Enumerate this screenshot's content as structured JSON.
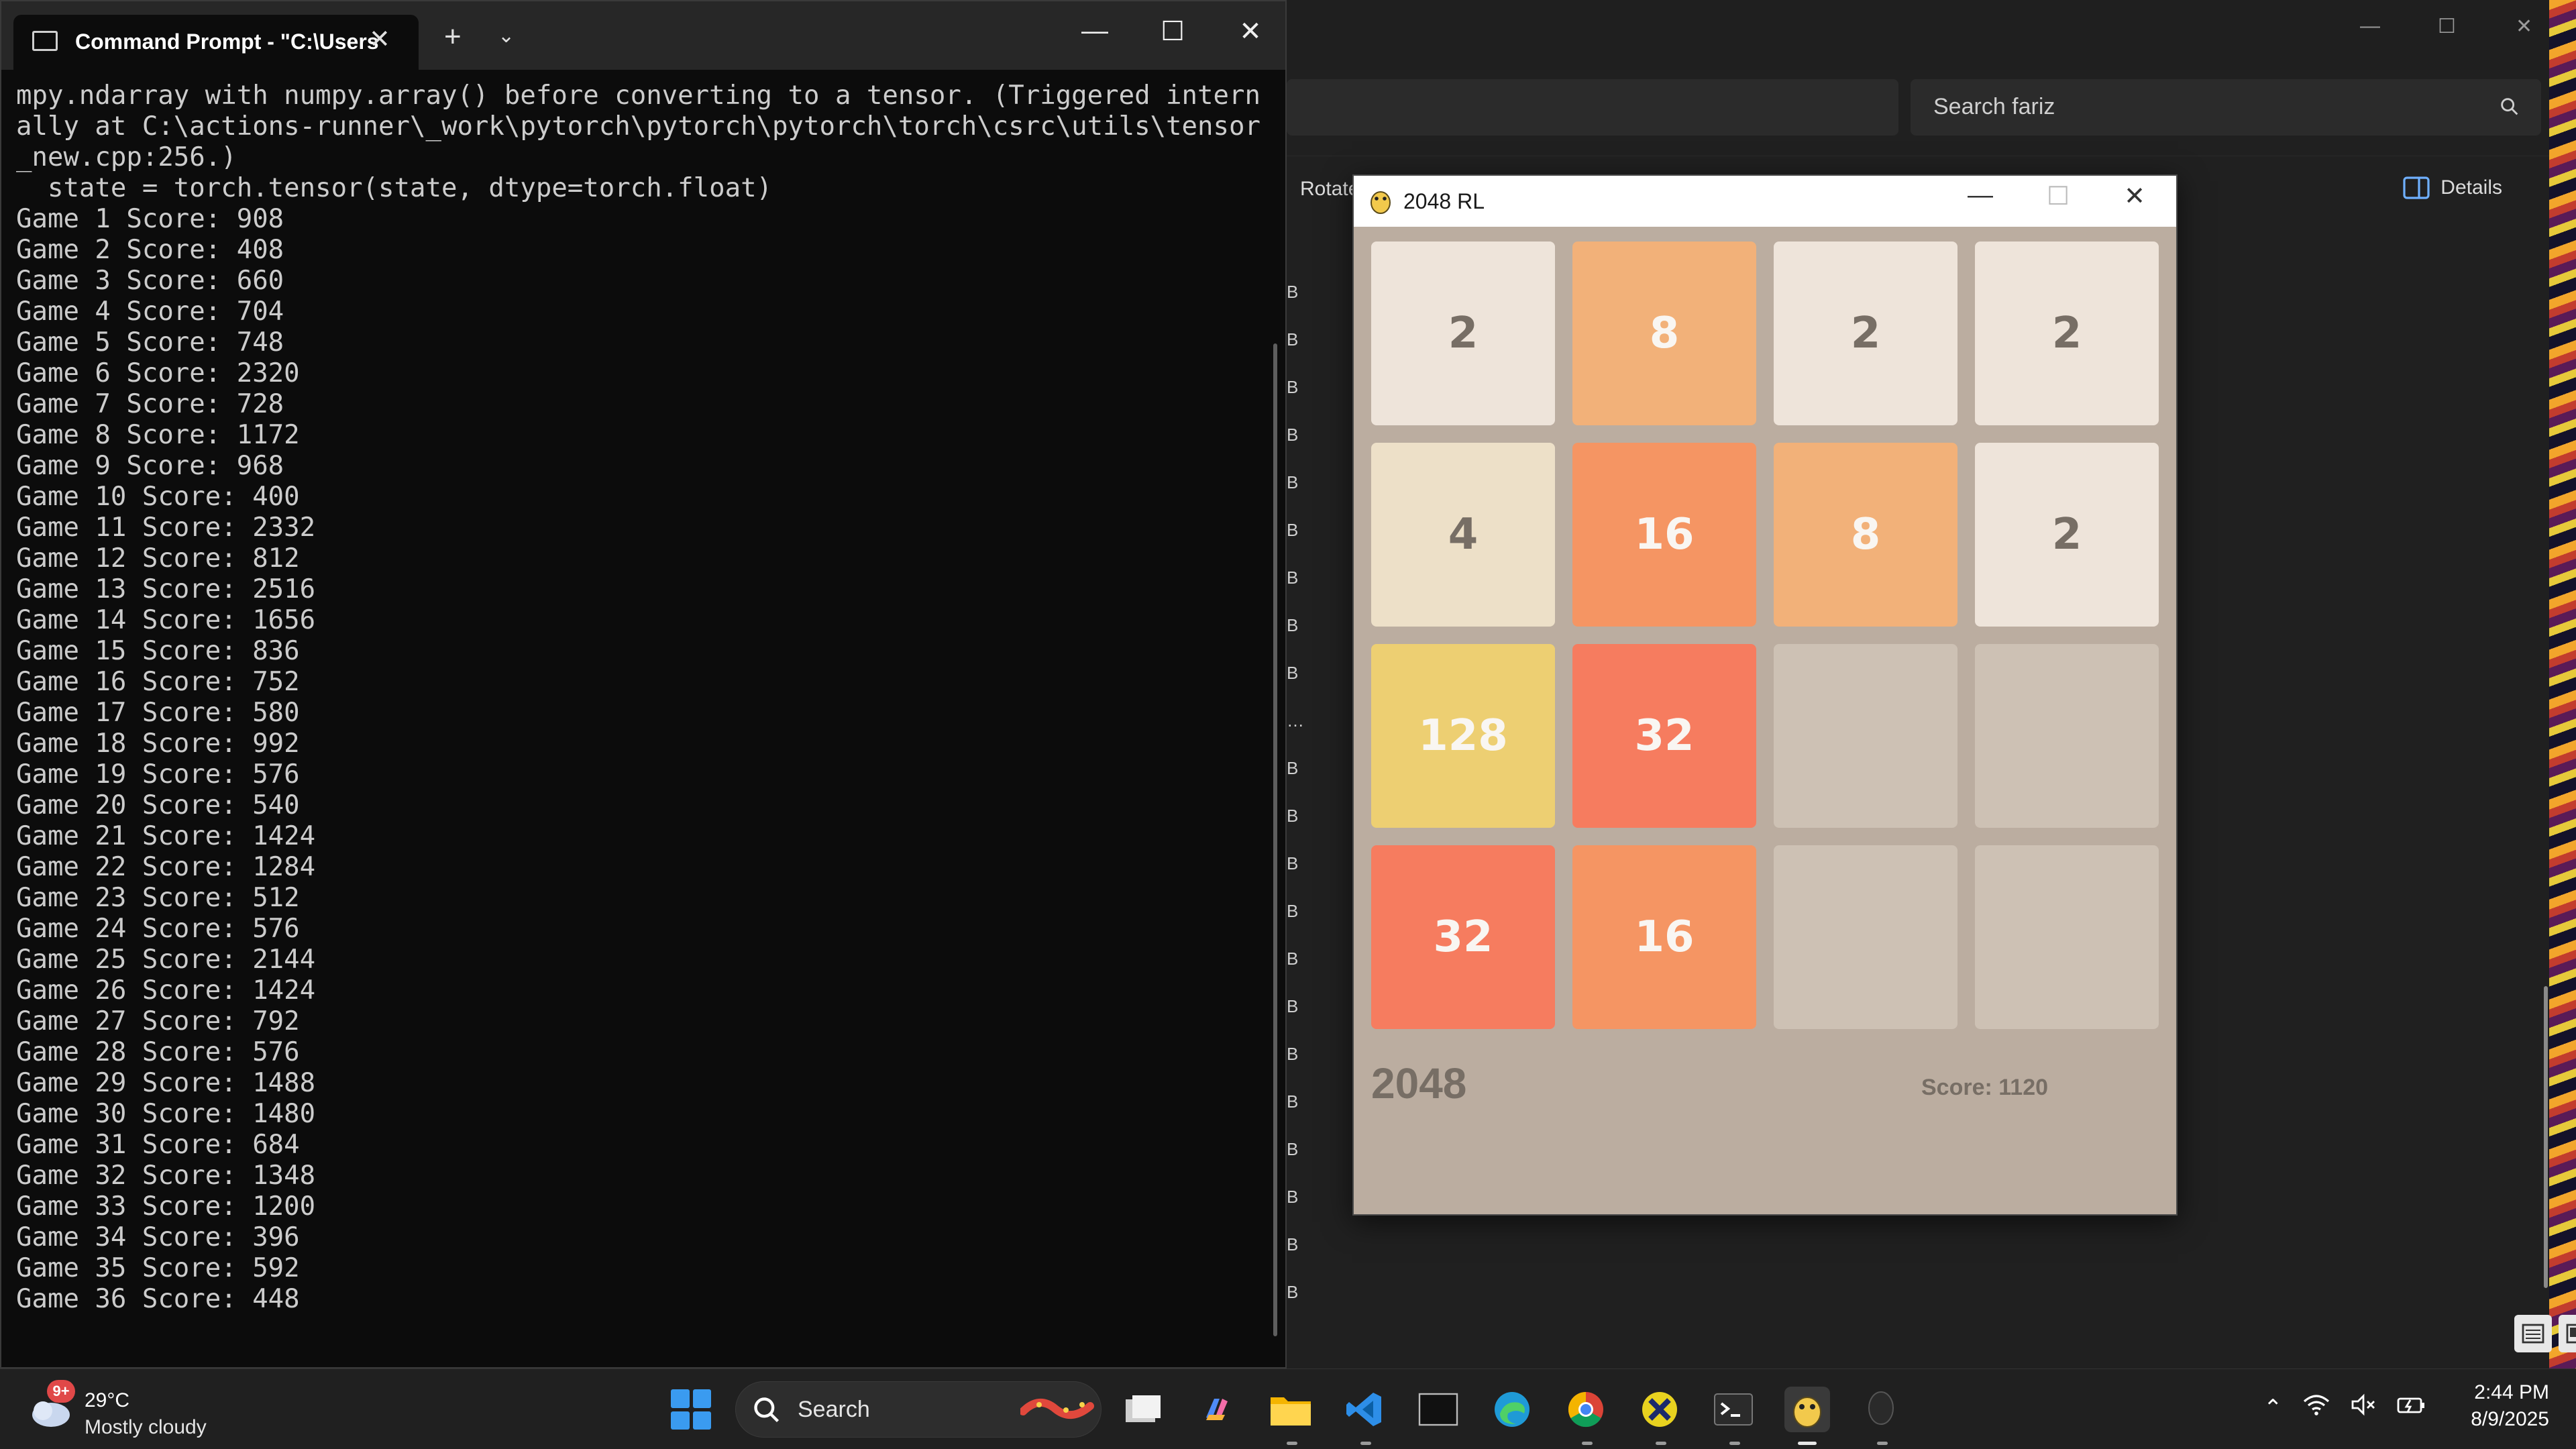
{
  "explorer": {
    "search_placeholder": "Search fariz",
    "toolbar_rotate": "Rotate",
    "toolbar_details": "Details",
    "size_column_marks": [
      "B",
      "B",
      "B",
      "B",
      "B",
      "B",
      "B",
      "B",
      "B",
      "…",
      "B",
      "B",
      "B",
      "B",
      "B",
      "B",
      "B",
      "B",
      "B",
      "B",
      "B",
      "B"
    ]
  },
  "cmd": {
    "tab_title": "Command Prompt - \"C:\\Users",
    "lines": [
      "mpy.ndarray with numpy.array() before converting to a tensor. (Triggered intern",
      "ally at C:\\actions-runner\\_work\\pytorch\\pytorch\\pytorch\\torch\\csrc\\utils\\tensor",
      "_new.cpp:256.)",
      "  state = torch.tensor(state, dtype=torch.float)",
      "Game 1 Score: 908",
      "Game 2 Score: 408",
      "Game 3 Score: 660",
      "Game 4 Score: 704",
      "Game 5 Score: 748",
      "Game 6 Score: 2320",
      "Game 7 Score: 728",
      "Game 8 Score: 1172",
      "Game 9 Score: 968",
      "Game 10 Score: 400",
      "Game 11 Score: 2332",
      "Game 12 Score: 812",
      "Game 13 Score: 2516",
      "Game 14 Score: 1656",
      "Game 15 Score: 836",
      "Game 16 Score: 752",
      "Game 17 Score: 580",
      "Game 18 Score: 992",
      "Game 19 Score: 576",
      "Game 20 Score: 540",
      "Game 21 Score: 1424",
      "Game 22 Score: 1284",
      "Game 23 Score: 512",
      "Game 24 Score: 576",
      "Game 25 Score: 2144",
      "Game 26 Score: 1424",
      "Game 27 Score: 792",
      "Game 28 Score: 576",
      "Game 29 Score: 1488",
      "Game 30 Score: 1480",
      "Game 31 Score: 684",
      "Game 32 Score: 1348",
      "Game 33 Score: 1200",
      "Game 34 Score: 396",
      "Game 35 Score: 592",
      "Game 36 Score: 448"
    ]
  },
  "game": {
    "window_title": "2048 RL",
    "board": [
      [
        "2",
        "8",
        "2",
        "2"
      ],
      [
        "4",
        "16",
        "8",
        "2"
      ],
      [
        "128",
        "32",
        "",
        ""
      ],
      [
        "32",
        "16",
        "",
        ""
      ]
    ],
    "tile_colors": {
      "": {
        "bg": "#cdc1b4",
        "fg": "#776e65"
      },
      "2": {
        "bg": "#eee4da",
        "fg": "#776e65"
      },
      "4": {
        "bg": "#ede0c8",
        "fg": "#776e65"
      },
      "8": {
        "bg": "#f2b179",
        "fg": "#f9f6f2"
      },
      "16": {
        "bg": "#f59563",
        "fg": "#f9f6f2"
      },
      "32": {
        "bg": "#f67c5f",
        "fg": "#f9f6f2"
      },
      "128": {
        "bg": "#edcf72",
        "fg": "#f9f6f2"
      }
    },
    "name": "2048",
    "score_text": "Score: 1120"
  },
  "taskbar": {
    "weather_badge": "9+",
    "weather_temp": "29°C",
    "weather_desc": "Mostly cloudy",
    "search_label": "Search",
    "apps": [
      "task-view",
      "copilot",
      "file-explorer",
      "vscode",
      "black-terminal",
      "edge",
      "chrome",
      "xbox-bar",
      "windows-terminal",
      "python-pygame",
      "unknown-app"
    ],
    "time": "2:44 PM",
    "date": "8/9/2025"
  }
}
